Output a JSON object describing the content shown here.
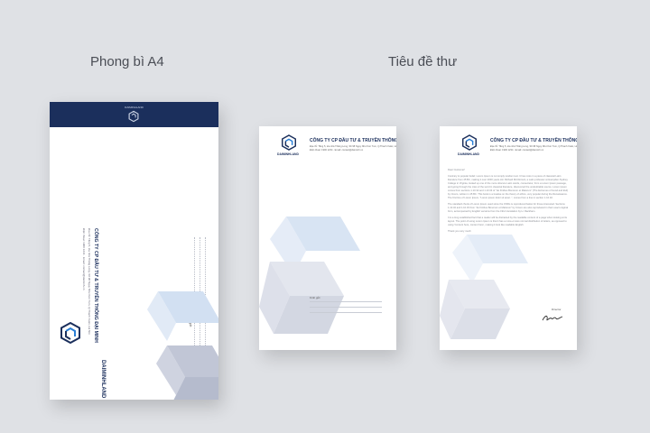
{
  "captions": {
    "envelope": "Phong bì A4",
    "letterhead": "Tiêu đề thư"
  },
  "brand": {
    "name": "DAIMINHLAND",
    "company": "CÔNG TY CP ĐẦU TƯ & TRUYỀN THÔNG ĐẠI MINH",
    "address": "Địa chỉ: Tầng 5, tòa nhà Thăng Long, Số 98 Ngụy Như Kon Tum, Q.Thanh Xuân, Hà Nội",
    "contact": "Điện thoại: 1900 1234 · Email: contact@daiminh.vn",
    "flap_text": "DAIMINHLAND",
    "primary_color": "#1b2f5c",
    "pattern_colors": [
      "#c9d9ee",
      "#b6bccd"
    ]
  },
  "envelope": {
    "recipient_label": "Kính gửi:"
  },
  "letterhead1": {
    "recipient_label": "Kính gửi:"
  },
  "letterhead2": {
    "greeting": "Dear Customer!",
    "paragraph1": "Contrary to popular belief, Lorem Ipsum is not simply random text. It has roots in a piece of classical Latin literature from 45 BC, making it over 2000 years old. Richard McClintock, a Latin professor at Hampden-Sydney College in Virginia, looked up one of the more obscure Latin words, consectetur, from a Lorem Ipsum passage, and going through the cites of the word in classical literature, discovered the undoubtable source. Lorem Ipsum comes from sections 1.10.32 and 1.10.33 of \"de Finibus Bonorum et Malorum\" (The Extremes of Good and Evil) by Cicero, written in 45 BC. This book is a treatise on the theory of ethics, very popular during the Renaissance. The first line of Lorem Ipsum, \"Lorem ipsum dolor sit amet..\", comes from a line in section 1.10.32.",
    "paragraph2": "The standard chunk of Lorem Ipsum used since the 1500s is reproduced below for those interested. Sections 1.10.32 and 1.10.33 from \"de Finibus Bonorum et Malorum\" by Cicero are also reproduced in their exact original form, accompanied by English versions from the 1914 translation by H. Rackham.",
    "paragraph3": "It is a long established fact that a reader will be distracted by the readable content of a page when looking at its layout. The point of using Lorem Ipsum is that it has a more-or-less normal distribution of letters, as opposed to using 'Content here, content here', making it look like readable English.",
    "closing": "Thank you very much",
    "sign_label": "Director"
  }
}
